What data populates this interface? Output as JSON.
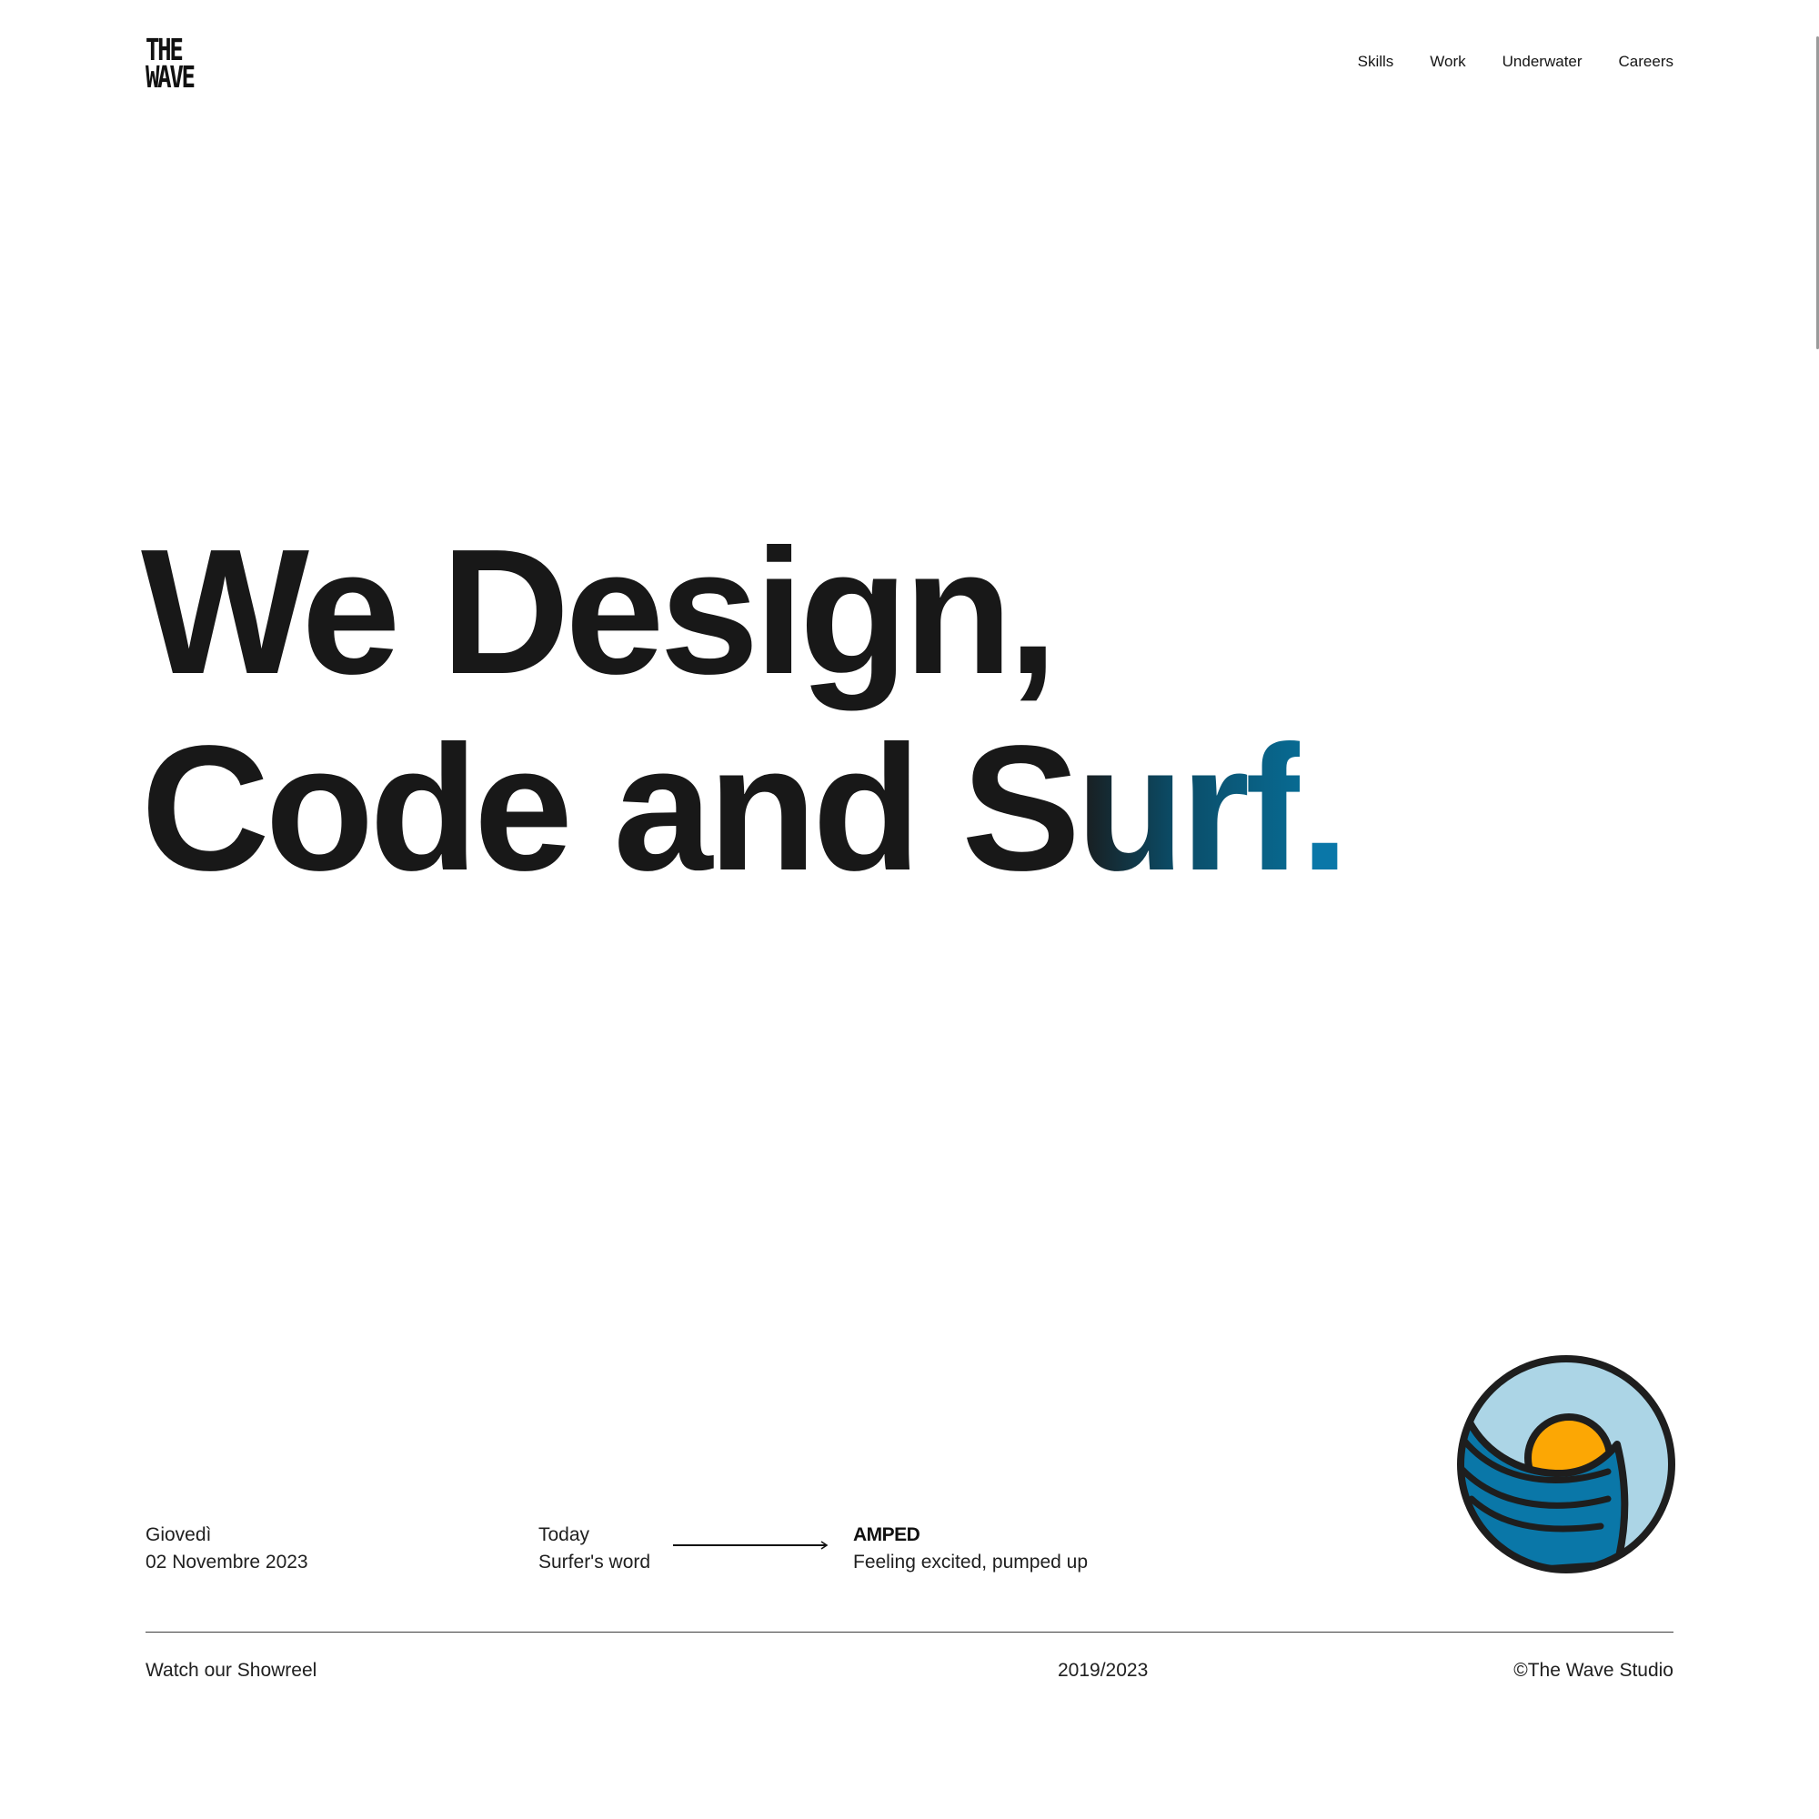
{
  "logo": {
    "line1": "THE",
    "line2": "WAVE"
  },
  "nav": {
    "items": [
      {
        "label": "Skills"
      },
      {
        "label": "Work"
      },
      {
        "label": "Underwater"
      },
      {
        "label": "Careers"
      }
    ]
  },
  "hero": {
    "line1": "We Design,",
    "line2_start": "Code and S",
    "line2_gradient": "urf",
    "line2_end": ".",
    "gradient_colors": [
      "#1a1a1a",
      "#0b4a64",
      "#086a92"
    ],
    "dot_color": "#0a77a8"
  },
  "info": {
    "day": "Giovedì",
    "date": "02 Novembre 2023",
    "today_label": "Today",
    "word_label": "Surfer's word",
    "word": "AMPED",
    "definition": "Feeling excited, pumped up"
  },
  "badge": {
    "icon": "wave-sun-icon",
    "colors": {
      "sky": "#acd5e6",
      "sun": "#fca704",
      "wave": "#0a77a8",
      "outline": "#1e1e1e"
    }
  },
  "footer": {
    "showreel": "Watch our Showreel",
    "years": "2019/2023",
    "copyright": "©The Wave Studio"
  }
}
